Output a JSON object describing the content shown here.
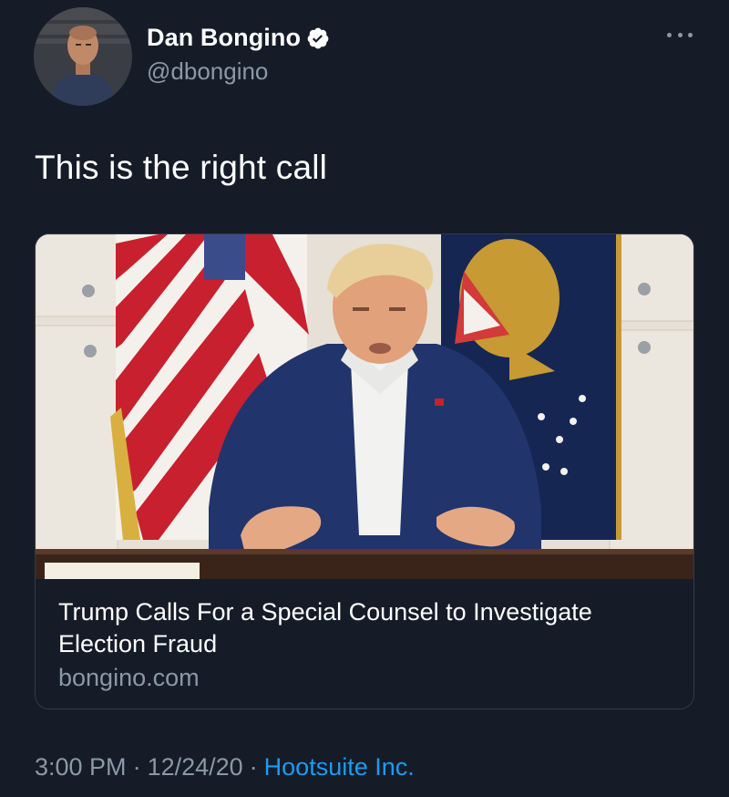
{
  "author": {
    "display_name": "Dan Bongino",
    "handle": "@dbongino",
    "verified": true,
    "avatar_icon": "profile-photo"
  },
  "tweet": {
    "text": "This is the right call"
  },
  "card": {
    "image_icon": "video-thumbnail",
    "title": "Trump Calls For a Special Counsel to Investigate Election Fraud",
    "domain": "bongino.com"
  },
  "meta": {
    "time": "3:00 PM",
    "date": "12/24/20",
    "separator": "·",
    "source": "Hootsuite Inc."
  },
  "colors": {
    "background": "#151c28",
    "text_primary": "#ffffff",
    "text_secondary": "#8b98a5",
    "link": "#1d9bf0",
    "verified_badge": "#ffffff"
  }
}
